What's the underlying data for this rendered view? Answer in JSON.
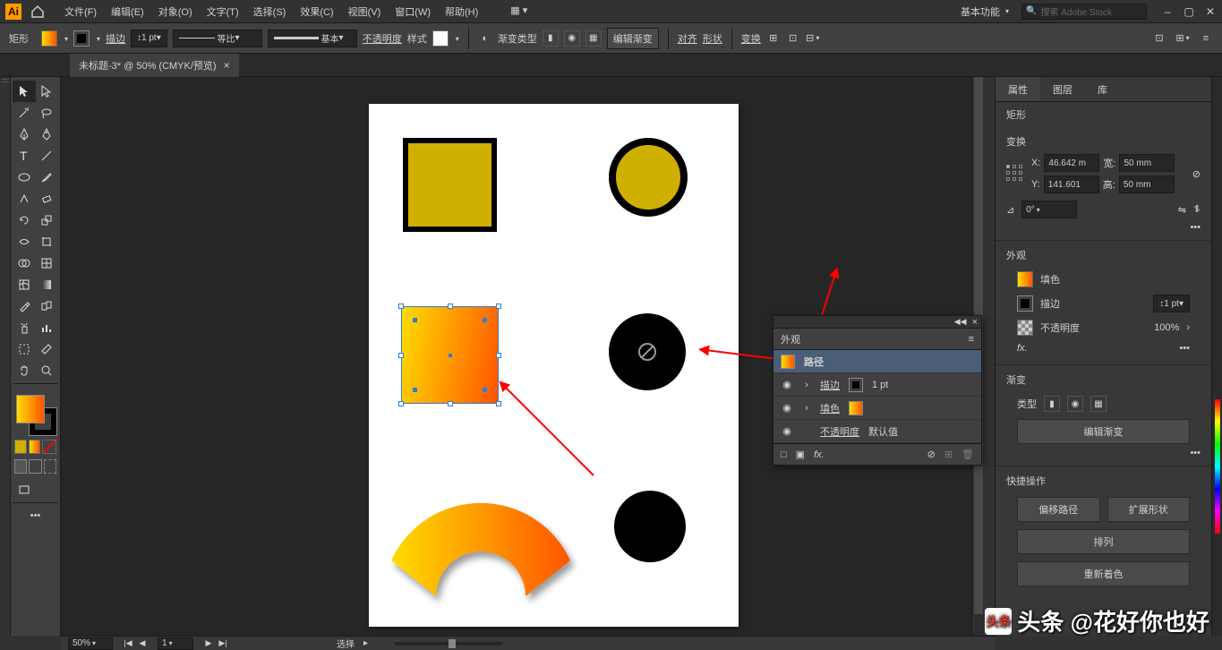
{
  "app": {
    "logo_text": "Ai"
  },
  "menu": {
    "file": "文件(F)",
    "edit": "编辑(E)",
    "object": "对象(O)",
    "type": "文字(T)",
    "select": "选择(S)",
    "effect": "效果(C)",
    "view": "视图(V)",
    "window": "窗口(W)",
    "help": "帮助(H)"
  },
  "workspace": "基本功能",
  "search_placeholder": "搜索 Adobe Stock",
  "control": {
    "shape_label": "矩形",
    "stroke_label": "描边",
    "stroke_weight": "1 pt",
    "profile_label": "等比",
    "brush_label": "基本",
    "opacity_label": "不透明度",
    "style_label": "样式",
    "grad_type_label": "渐变类型",
    "edit_grad": "编辑渐变",
    "align_label": "对齐",
    "shape2_label": "形状",
    "transform_label": "变换"
  },
  "doc_tab": "未标题-3* @ 50% (CMYK/预览)",
  "appearance": {
    "title": "外观",
    "path": "路径",
    "stroke": "描边",
    "stroke_val": "1 pt",
    "fill": "填色",
    "opacity": "不透明度",
    "opacity_val": "默认值"
  },
  "right_panel": {
    "tabs": {
      "properties": "属性",
      "layers": "图层",
      "libraries": "库"
    },
    "shape_heading": "矩形",
    "transform": {
      "heading": "变换",
      "x_label": "X:",
      "x": "46.642 m",
      "y_label": "Y:",
      "y": "141.601",
      "w_label": "宽:",
      "w": "50 mm",
      "h_label": "高:",
      "h": "50 mm",
      "angle_label": "⊿",
      "angle": "0°"
    },
    "appearance": {
      "heading": "外观",
      "fill": "填色",
      "stroke": "描边",
      "stroke_val": "1 pt",
      "opacity": "不透明度",
      "opacity_val": "100%",
      "fx": "fx."
    },
    "gradient": {
      "heading": "渐变",
      "type_label": "类型",
      "edit_btn": "编辑渐变"
    },
    "quick": {
      "heading": "快捷操作",
      "offset": "偏移路径",
      "expand": "扩展形状",
      "arrange": "排列",
      "recolor": "重新着色"
    }
  },
  "status": {
    "zoom": "50%",
    "artboard": "1",
    "label": "选择"
  },
  "watermark": "头条 @花好你也好"
}
